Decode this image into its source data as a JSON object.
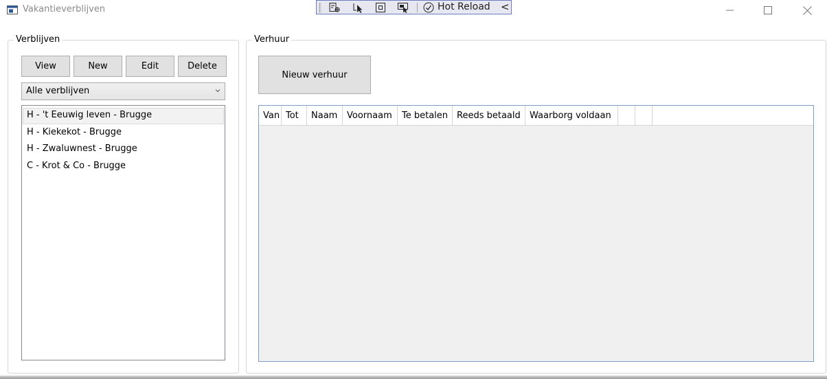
{
  "window": {
    "title": "Vakantieverblijven",
    "icon": "window-app-icon",
    "controls": [
      "minimize-icon",
      "maximize-icon",
      "close-icon"
    ]
  },
  "debug_toolbar": {
    "tools": [
      "live-visual-tree-icon",
      "select-element-icon",
      "display-layout-adorners-icon",
      "track-focus-icon"
    ],
    "hot_reload_label": "Hot Reload",
    "collapse_glyph": "<"
  },
  "verblijven": {
    "title": "Verblijven",
    "buttons": {
      "view": "View",
      "new": "New",
      "edit": "Edit",
      "delete": "Delete"
    },
    "filter": {
      "selected": "Alle verblijven"
    },
    "items": [
      {
        "label": "H - 't Eeuwig leven - Brugge",
        "selected": true
      },
      {
        "label": "H - Kiekekot - Brugge",
        "selected": false
      },
      {
        "label": "H - Zwaluwnest - Brugge",
        "selected": false
      },
      {
        "label": "C - Krot & Co - Brugge",
        "selected": false
      }
    ]
  },
  "verhuur": {
    "title": "Verhuur",
    "new_button": "Nieuw verhuur",
    "columns": [
      "Van",
      "Tot",
      "Naam",
      "Voornaam",
      "Te betalen",
      "Reeds betaald",
      "Waarborg voldaan",
      "",
      ""
    ],
    "rows": []
  },
  "colors": {
    "button_bg": "#e1e1e1",
    "grid_border": "#7e9cc4",
    "debug_toolbar_bg": "#e6e7f0",
    "debug_toolbar_border": "#6b7bbf"
  }
}
